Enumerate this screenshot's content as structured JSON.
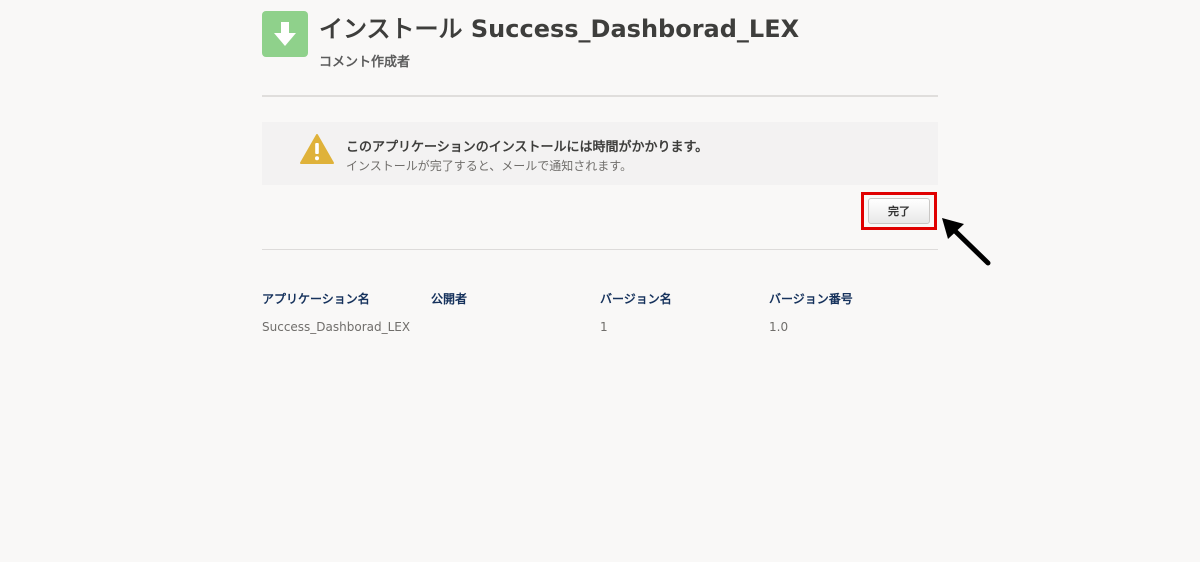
{
  "header": {
    "title": "インストール Success_Dashborad_LEX",
    "subtitle": "コメント作成者",
    "icon": "download-icon",
    "icon_color": "#8fd18b"
  },
  "notice": {
    "icon": "warning-icon",
    "icon_color": "#dfb23a",
    "title": "このアプリケーションのインストールには時間がかかります。",
    "body": "インストールが完了すると、メールで通知されます。"
  },
  "actions": {
    "done_label": "完了",
    "highlight_color": "#e00000"
  },
  "table": {
    "headers": [
      "アプリケーション名",
      "公開者",
      "バージョン名",
      "バージョン番号"
    ],
    "rows": [
      [
        "Success_Dashborad_LEX",
        "",
        "1",
        "1.0"
      ]
    ]
  }
}
